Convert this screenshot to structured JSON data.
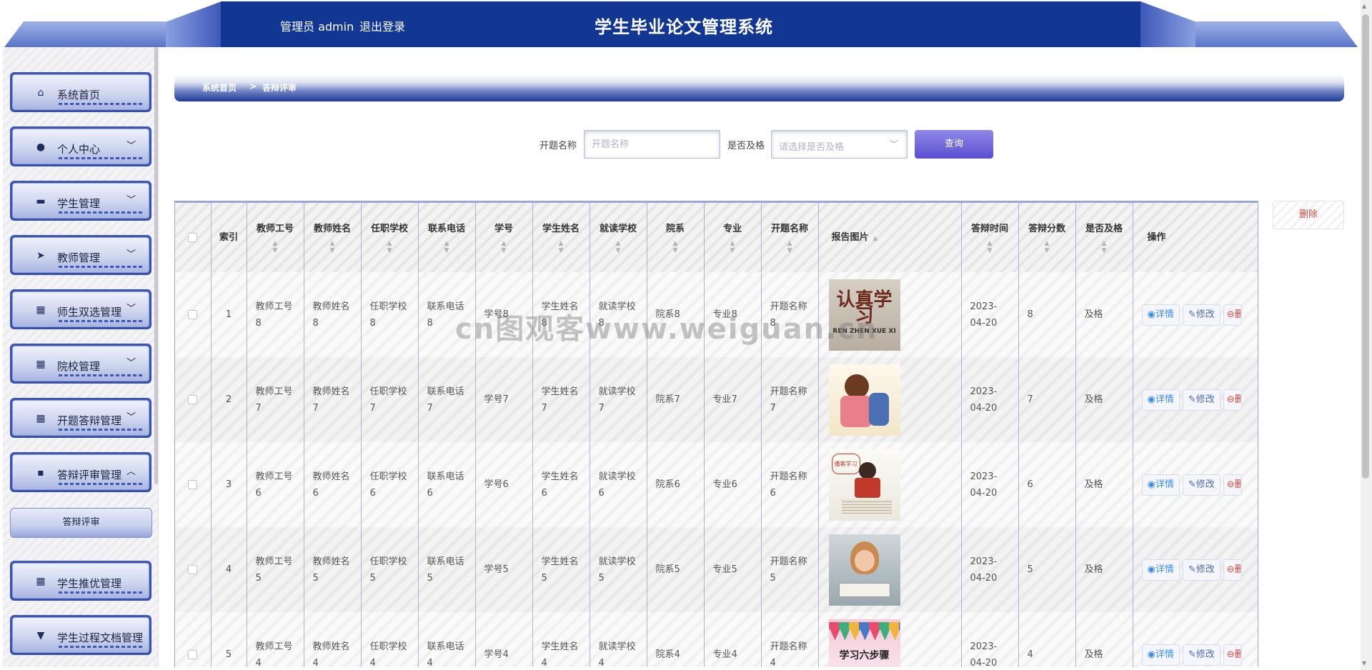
{
  "header": {
    "user_label": "管理员 admin",
    "logout_label": "退出登录",
    "title": "学生毕业论文管理系统"
  },
  "sidebar": {
    "items": [
      {
        "label": "系统首页",
        "icon": "home-icon",
        "arrow": ""
      },
      {
        "label": "个人中心",
        "icon": "user-icon",
        "arrow": "﹀"
      },
      {
        "label": "学生管理",
        "icon": "monitor-icon",
        "arrow": "﹀"
      },
      {
        "label": "教师管理",
        "icon": "send-icon",
        "arrow": "﹀"
      },
      {
        "label": "师生双选管理",
        "icon": "grid-icon",
        "arrow": "﹀"
      },
      {
        "label": "院校管理",
        "icon": "grid-icon",
        "arrow": "﹀"
      },
      {
        "label": "开题答辩管理",
        "icon": "grid-icon",
        "arrow": "﹀"
      },
      {
        "label": "答辩评审管理",
        "icon": "chat-icon",
        "arrow": "︿"
      },
      {
        "label": "学生推优管理",
        "icon": "grid-icon",
        "arrow": ""
      },
      {
        "label": "学生过程文档管理",
        "icon": "pin-icon",
        "arrow": ""
      }
    ],
    "subitem_label": "答辩评审"
  },
  "breadcrumb": {
    "home": "系统首页",
    "separator": ">",
    "current": "答辩评审"
  },
  "search": {
    "title_label": "开题名称",
    "title_placeholder": "开题名称",
    "pass_label": "是否及格",
    "pass_placeholder": "请选择是否及格",
    "query_label": "查询"
  },
  "delete_label": "删除",
  "table": {
    "headers": {
      "index": "索引",
      "teacher_no": "教师工号",
      "teacher_name": "教师姓名",
      "school": "任职学校",
      "phone": "联系电话",
      "student_no": "学号",
      "student_name": "学生姓名",
      "study_school": "就读学校",
      "department": "院系",
      "major": "专业",
      "topic": "开题名称",
      "report_image": "报告图片",
      "defense_time": "答辩时间",
      "score": "答辩分数",
      "passed": "是否及格",
      "ops": "操作"
    },
    "rows": [
      {
        "index": "1",
        "teacher_no": "教师工号8",
        "teacher_name": "教师姓名8",
        "school": "任职学校8",
        "phone": "联系电话8",
        "student_no": "学号8",
        "student_name": "学生姓名8",
        "study_school": "就读学校8",
        "department": "院系8",
        "major": "专业8",
        "topic": "开题名称8",
        "image_text": "认真学习",
        "image_subtext": "REN ZHEN XUE XI",
        "defense_time": "2023-04-20",
        "score": "8",
        "passed": "及格"
      },
      {
        "index": "2",
        "teacher_no": "教师工号7",
        "teacher_name": "教师姓名7",
        "school": "任职学校7",
        "phone": "联系电话7",
        "student_no": "学号7",
        "student_name": "学生姓名7",
        "study_school": "就读学校7",
        "department": "院系7",
        "major": "专业7",
        "topic": "开题名称7",
        "image_text": "",
        "image_subtext": "",
        "defense_time": "2023-04-20",
        "score": "7",
        "passed": "及格"
      },
      {
        "index": "3",
        "teacher_no": "教师工号6",
        "teacher_name": "教师姓名6",
        "school": "任职学校6",
        "phone": "联系电话6",
        "student_no": "学号6",
        "student_name": "学生姓名6",
        "study_school": "就读学校6",
        "department": "院系6",
        "major": "专业6",
        "topic": "开题名称6",
        "image_text": "播客学习",
        "image_subtext": "",
        "defense_time": "2023-04-20",
        "score": "6",
        "passed": "及格"
      },
      {
        "index": "4",
        "teacher_no": "教师工号5",
        "teacher_name": "教师姓名5",
        "school": "任职学校5",
        "phone": "联系电话5",
        "student_no": "学号5",
        "student_name": "学生姓名5",
        "study_school": "就读学校5",
        "department": "院系5",
        "major": "专业5",
        "topic": "开题名称5",
        "image_text": "",
        "image_subtext": "",
        "defense_time": "2023-04-20",
        "score": "5",
        "passed": "及格"
      },
      {
        "index": "5",
        "teacher_no": "教师工号4",
        "teacher_name": "教师姓名4",
        "school": "任职学校4",
        "phone": "联系电话4",
        "student_no": "学号4",
        "student_name": "学生姓名4",
        "study_school": "就读学校4",
        "department": "院系4",
        "major": "专业4",
        "topic": "开题名称4",
        "image_text": "学习六步骤",
        "image_subtext": "",
        "defense_time": "2023-04-20",
        "score": "4",
        "passed": "及格"
      }
    ],
    "op_detail": "详情",
    "op_edit": "修改",
    "op_delete": "删除"
  },
  "watermark": "cn图观客www.weiguan.cn",
  "colors": {
    "header_blue": "#123792",
    "accent_purple": "#5b4fd0",
    "link_blue": "#3c8de8",
    "danger_red": "#e0453c"
  }
}
